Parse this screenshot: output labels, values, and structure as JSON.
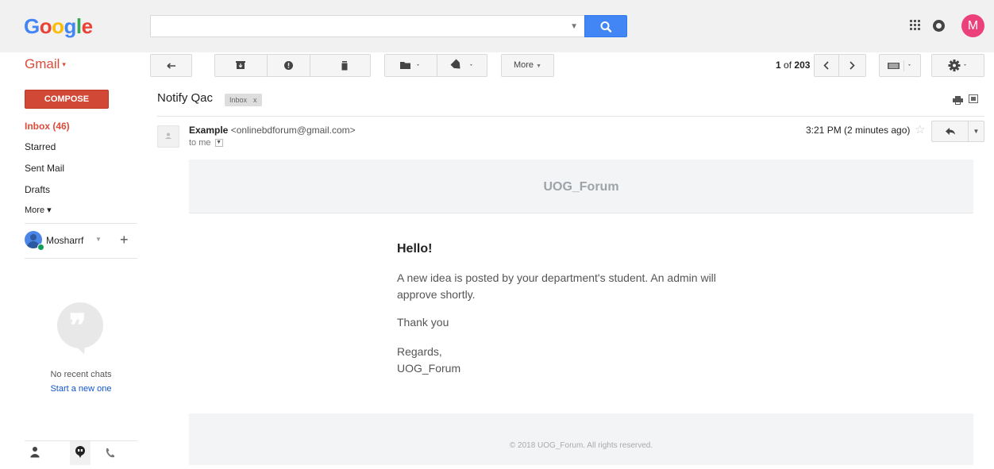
{
  "header": {
    "logo_letters": [
      {
        "ch": "G",
        "color": "#4285F4"
      },
      {
        "ch": "o",
        "color": "#EA4335"
      },
      {
        "ch": "o",
        "color": "#FBBC05"
      },
      {
        "ch": "g",
        "color": "#4285F4"
      },
      {
        "ch": "l",
        "color": "#34A853"
      },
      {
        "ch": "e",
        "color": "#EA4335"
      }
    ],
    "search_value": "",
    "search_icon": "search-icon",
    "avatar_letter": "M",
    "avatar_color": "#ec407a"
  },
  "app": {
    "label": "Gmail",
    "caret": "▾"
  },
  "toolbar": {
    "more_label": "More",
    "pager_current": "1",
    "pager_sep": "of",
    "pager_total": "203",
    "icons": [
      "back-arrow-icon",
      "archive-icon",
      "report-spam-icon",
      "delete-icon",
      "folder-icon",
      "label-icon",
      "chevron-left-icon",
      "chevron-right-icon",
      "keyboard-icon",
      "gear-icon"
    ]
  },
  "sidebar": {
    "compose_label": "COMPOSE",
    "items": [
      {
        "label": "Inbox (46)",
        "active": true
      },
      {
        "label": "Starred",
        "active": false
      },
      {
        "label": "Sent Mail",
        "active": false
      },
      {
        "label": "Drafts",
        "active": false
      },
      {
        "label": "More ▾",
        "active": false
      }
    ],
    "user_name": "Mosharrf",
    "no_recent_chats": "No recent chats",
    "start_new": "Start a new one"
  },
  "message": {
    "subject": "Notify Qac",
    "label_chip": "Inbox",
    "label_chip_close": "x",
    "sender_name": "Example",
    "sender_email": "<onlinebdforum@gmail.com>",
    "to": "to me",
    "time": "3:21 PM (2 minutes ago)"
  },
  "email_body": {
    "brand": "UOG_Forum",
    "greeting": "Hello!",
    "paragraph": "A new idea is posted by your department's student. An admin will approve shortly.",
    "thanks": "Thank you",
    "regards": "Regards,",
    "signature": "UOG_Forum",
    "footer": "© 2018 UOG_Forum. All rights reserved."
  }
}
